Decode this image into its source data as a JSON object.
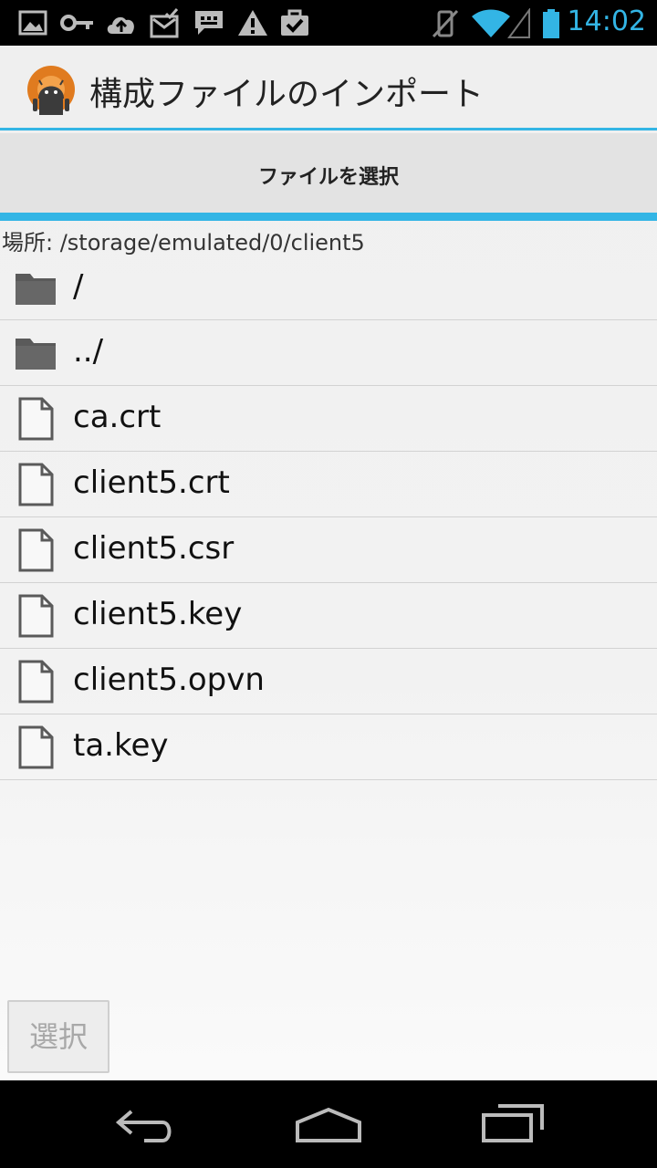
{
  "status_bar": {
    "time": "14:02",
    "icons": [
      "image-notification-icon",
      "key-icon",
      "cloud-upload-icon",
      "mail-check-icon",
      "chat-icon",
      "warning-icon",
      "briefcase-check-icon",
      "vibrate-off-icon",
      "wifi-icon",
      "signal-icon",
      "battery-icon"
    ],
    "accent_color": "#33b5e5"
  },
  "action_bar": {
    "title": "構成ファイルのインポート",
    "logo_icon": "openvpn-android-logo-icon"
  },
  "tab": {
    "label": "ファイルを選択"
  },
  "location": {
    "text": "場所: /storage/emulated/0/client5"
  },
  "files": [
    {
      "name": "/",
      "icon": "folder-icon"
    },
    {
      "name": "../",
      "icon": "folder-icon"
    },
    {
      "name": "ca.crt",
      "icon": "file-icon"
    },
    {
      "name": "client5.crt",
      "icon": "file-icon"
    },
    {
      "name": "client5.csr",
      "icon": "file-icon"
    },
    {
      "name": "client5.key",
      "icon": "file-icon"
    },
    {
      "name": "client5.opvn",
      "icon": "file-icon"
    },
    {
      "name": "ta.key",
      "icon": "file-icon"
    }
  ],
  "select_button": {
    "label": "選択"
  },
  "nav_bar": {
    "icons": [
      "back-icon",
      "home-icon",
      "recent-apps-icon"
    ]
  }
}
